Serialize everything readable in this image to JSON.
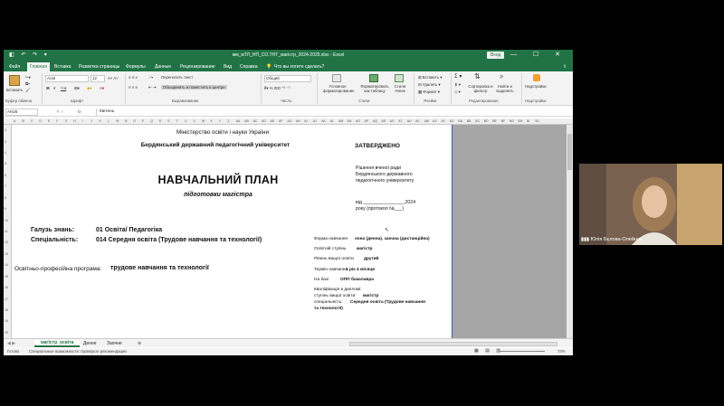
{
  "window": {
    "title": "мм_мТЛ_НП_СО.ТНТ_магістр_2024-2025.xlsx  -  Excel",
    "account_button": "Вход",
    "quick_access": "◧ ↶ ↷ ▾",
    "window_controls": "— ☐ ✕"
  },
  "ribbon_tabs": [
    "Файл",
    "Главная",
    "Вставка",
    "Разметка страницы",
    "Формулы",
    "Данные",
    "Рецензирование",
    "Вид",
    "Справка"
  ],
  "tell_me": "Что вы хотите сделать?",
  "ribbon": {
    "clipboard": {
      "paste": "Вставить",
      "group": "Буфер обмена"
    },
    "font": {
      "name": "Arial",
      "size": "12",
      "group": "Шрифт"
    },
    "alignment": {
      "wrap": "Переносить текст",
      "merge": "Объединить и поместить в центре",
      "group": "Выравнивание"
    },
    "number": {
      "format": "Общий",
      "group": "Число"
    },
    "styles": {
      "conditional": "Условное форматирование",
      "table": "Форматировать как таблицу",
      "cell_styles": "Стили ячеек",
      "group": "Стили"
    },
    "cells": {
      "insert": "Вставить",
      "delete": "Удалить",
      "format": "Формат",
      "group": "Ячейки"
    },
    "editing": {
      "sort": "Сортировка и фильтр",
      "find": "Найти и выделить",
      "group": "Редактирование"
    },
    "addins": {
      "label": "Надстройки",
      "group": "Надстройки"
    }
  },
  "formula_bar": {
    "cell_ref": "AH25",
    "fx": "fx",
    "content": "Квітень"
  },
  "columns": [
    "A",
    "B",
    "C",
    "D",
    "E",
    "F",
    "G",
    "H",
    "I",
    "J",
    "K",
    "L",
    "M",
    "N",
    "O",
    "P",
    "Q",
    "R",
    "S",
    "T",
    "U",
    "V",
    "W",
    "X",
    "Y",
    "Z",
    "AA",
    "AB",
    "AC",
    "AD",
    "AE",
    "AF",
    "AG",
    "AH",
    "AI",
    "AJ",
    "AK",
    "AL",
    "AM",
    "AN",
    "AO",
    "AP",
    "AQ",
    "AR",
    "AS",
    "AT",
    "AU",
    "AV",
    "AW",
    "AX",
    "AY",
    "AZ",
    "BA",
    "BB",
    "BC",
    "BD",
    "BE",
    "BF",
    "BG",
    "BH",
    "BI",
    "BJ"
  ],
  "rows": [
    "2",
    "3",
    "4",
    "5",
    "6",
    "7",
    "8",
    "9",
    "10",
    "11",
    "12",
    "13",
    "14",
    "15",
    "16",
    "17",
    "18",
    "19",
    "20"
  ],
  "cells": {
    "ministry": "Міністерство освіти і науки України",
    "university": "Бердянський державний педагогічний університет",
    "approved": "ЗАТВЕРДЖЕНО",
    "plan_title": "НАВЧАЛЬНИЙ ПЛАН",
    "plan_sub": "підготовки магістра",
    "council1": "Рішення вченої ради",
    "council2": "Бердянського державного",
    "council3": "педагогічного університету",
    "date1": "від ________________2024",
    "date2": "року (протокол №___)",
    "field_label": "Галузь знань:",
    "field_value": "01 Освіта/ Педагогіка",
    "spec_label": "Спеціальність:",
    "spec_value": "014 Середня освіта (Трудове навчання та технології)",
    "prog_label": "Освітньо-професійна програма:",
    "prog_value": "трудове навчання та технології",
    "form_label": "Форма навчання",
    "form_value": "очна (денна), заочна (дистанційна)",
    "degree_label": "Освітній ступінь",
    "degree_value": "магістр",
    "level_label": "Рівень вищої освіти",
    "level_value": "другий",
    "term_label": "Термін навчання",
    "term_value": "1 рік 4 місяця",
    "base_label": "На базі",
    "base_value": "ОПП бакалавра",
    "qual1": "Кваліфікація в дипломі:",
    "qual2_label": "ступінь вищої освіти:",
    "qual2_value": "магістр",
    "qual3_label": "спеціальність:",
    "qual3_value": "Середня освіта (Трудове навчання",
    "qual4": "та технології)"
  },
  "sheet_tabs": [
    "магістр_освіта",
    "Денне",
    "Заочне"
  ],
  "status": {
    "ready": "Готово",
    "accessibility": "Специальные возможности: проверьте рекомендации",
    "zoom": "73%"
  },
  "participant": "Юлія Бєлова-Олейник",
  "colors": {
    "excel_green": "#217346",
    "selection_blue": "#3b5fb0"
  }
}
